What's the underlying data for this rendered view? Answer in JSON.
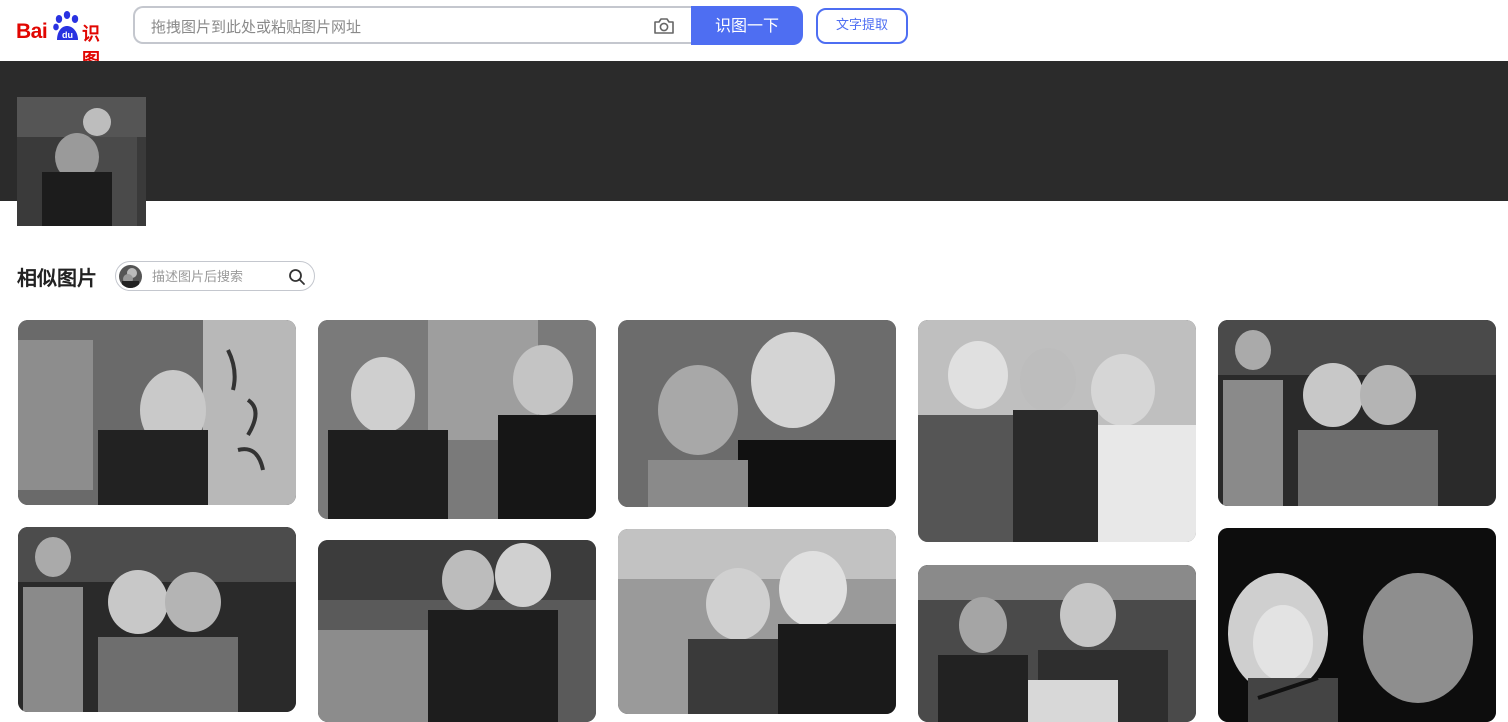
{
  "header": {
    "logo_latin": "Bai",
    "logo_du": "du",
    "logo_cn": "识图",
    "search_placeholder": "拖拽图片到此处或粘贴图片网址",
    "search_button": "识图一下",
    "ocr_button": "文字提取",
    "camera_icon": "camera-icon"
  },
  "similar": {
    "title": "相似图片",
    "search_placeholder": "描述图片后搜索",
    "search_icon": "search-icon"
  },
  "colors": {
    "brand_blue": "#4e6ef2",
    "brand_red": "#e10601",
    "band": "#2b2b2b"
  }
}
